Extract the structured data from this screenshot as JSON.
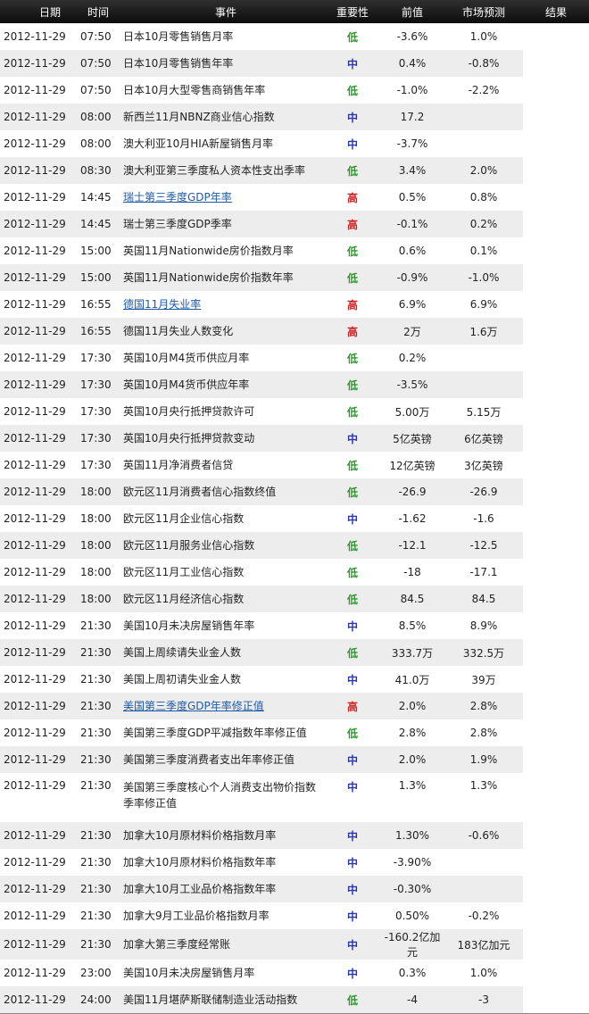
{
  "header": {
    "date": "日期",
    "time": "时间",
    "event": "事件",
    "importance": "重要性",
    "previous": "前值",
    "forecast": "市场预测",
    "result": "结果"
  },
  "colors": {
    "low": "#2a9a2a",
    "mid": "#2a37a8",
    "high": "#cc2222",
    "link": "#1f5aa6"
  },
  "rows": [
    {
      "date": "2012-11-29",
      "time": "07:50",
      "event": "日本10月零售销售月率",
      "importance": "低",
      "level": "low",
      "previous": "-3.6%",
      "forecast": "1.0%"
    },
    {
      "date": "2012-11-29",
      "time": "07:50",
      "event": "日本10月零售销售年率",
      "importance": "中",
      "level": "mid",
      "previous": "0.4%",
      "forecast": "-0.8%"
    },
    {
      "date": "2012-11-29",
      "time": "07:50",
      "event": "日本10月大型零售商销售年率",
      "importance": "低",
      "level": "low",
      "previous": "-1.0%",
      "forecast": "-2.2%"
    },
    {
      "date": "2012-11-29",
      "time": "08:00",
      "event": "新西兰11月NBNZ商业信心指数",
      "importance": "中",
      "level": "mid",
      "previous": "17.2",
      "forecast": ""
    },
    {
      "date": "2012-11-29",
      "time": "08:00",
      "event": "澳大利亚10月HIA新屋销售月率",
      "importance": "中",
      "level": "mid",
      "previous": "-3.7%",
      "forecast": ""
    },
    {
      "date": "2012-11-29",
      "time": "08:30",
      "event": "澳大利亚第三季度私人资本性支出季率",
      "importance": "低",
      "level": "low",
      "previous": "3.4%",
      "forecast": "2.0%"
    },
    {
      "date": "2012-11-29",
      "time": "14:45",
      "event": "瑞士第三季度GDP年率",
      "importance": "高",
      "level": "high",
      "previous": "0.5%",
      "forecast": "0.8%",
      "link": true
    },
    {
      "date": "2012-11-29",
      "time": "14:45",
      "event": "瑞士第三季度GDP季率",
      "importance": "高",
      "level": "high",
      "previous": "-0.1%",
      "forecast": "0.2%"
    },
    {
      "date": "2012-11-29",
      "time": "15:00",
      "event": "英国11月Nationwide房价指数月率",
      "importance": "低",
      "level": "low",
      "previous": "0.6%",
      "forecast": "0.1%"
    },
    {
      "date": "2012-11-29",
      "time": "15:00",
      "event": "英国11月Nationwide房价指数年率",
      "importance": "低",
      "level": "low",
      "previous": "-0.9%",
      "forecast": "-1.0%"
    },
    {
      "date": "2012-11-29",
      "time": "16:55",
      "event": "德国11月失业率",
      "importance": "高",
      "level": "high",
      "previous": "6.9%",
      "forecast": "6.9%",
      "link": true
    },
    {
      "date": "2012-11-29",
      "time": "16:55",
      "event": "德国11月失业人数变化",
      "importance": "高",
      "level": "high",
      "previous": "2万",
      "forecast": "1.6万"
    },
    {
      "date": "2012-11-29",
      "time": "17:30",
      "event": "英国10月M4货币供应月率",
      "importance": "低",
      "level": "low",
      "previous": "0.2%",
      "forecast": ""
    },
    {
      "date": "2012-11-29",
      "time": "17:30",
      "event": "英国10月M4货币供应年率",
      "importance": "低",
      "level": "low",
      "previous": "-3.5%",
      "forecast": ""
    },
    {
      "date": "2012-11-29",
      "time": "17:30",
      "event": "英国10月央行抵押贷款许可",
      "importance": "低",
      "level": "low",
      "previous": "5.00万",
      "forecast": "5.15万"
    },
    {
      "date": "2012-11-29",
      "time": "17:30",
      "event": "英国10月央行抵押贷款变动",
      "importance": "中",
      "level": "mid",
      "previous": "5亿英镑",
      "forecast": "6亿英镑"
    },
    {
      "date": "2012-11-29",
      "time": "17:30",
      "event": "英国11月净消费者信贷",
      "importance": "低",
      "level": "low",
      "previous": "12亿英镑",
      "forecast": "3亿英镑"
    },
    {
      "date": "2012-11-29",
      "time": "18:00",
      "event": "欧元区11月消费者信心指数终值",
      "importance": "低",
      "level": "low",
      "previous": "-26.9",
      "forecast": "-26.9"
    },
    {
      "date": "2012-11-29",
      "time": "18:00",
      "event": "欧元区11月企业信心指数",
      "importance": "中",
      "level": "mid",
      "previous": "-1.62",
      "forecast": "-1.6"
    },
    {
      "date": "2012-11-29",
      "time": "18:00",
      "event": "欧元区11月服务业信心指数",
      "importance": "低",
      "level": "low",
      "previous": "-12.1",
      "forecast": "-12.5"
    },
    {
      "date": "2012-11-29",
      "time": "18:00",
      "event": "欧元区11月工业信心指数",
      "importance": "低",
      "level": "low",
      "previous": "-18",
      "forecast": "-17.1"
    },
    {
      "date": "2012-11-29",
      "time": "18:00",
      "event": "欧元区11月经济信心指数",
      "importance": "低",
      "level": "low",
      "previous": "84.5",
      "forecast": "84.5"
    },
    {
      "date": "2012-11-29",
      "time": "21:30",
      "event": "美国10月未决房屋销售年率",
      "importance": "中",
      "level": "mid",
      "previous": "8.5%",
      "forecast": "8.9%"
    },
    {
      "date": "2012-11-29",
      "time": "21:30",
      "event": "美国上周续请失业金人数",
      "importance": "低",
      "level": "low",
      "previous": "333.7万",
      "forecast": "332.5万"
    },
    {
      "date": "2012-11-29",
      "time": "21:30",
      "event": "美国上周初请失业金人数",
      "importance": "中",
      "level": "mid",
      "previous": "41.0万",
      "forecast": "39万"
    },
    {
      "date": "2012-11-29",
      "time": "21:30",
      "event": "美国第三季度GDP年率修正值",
      "importance": "高",
      "level": "high",
      "previous": "2.0%",
      "forecast": "2.8%",
      "link": true
    },
    {
      "date": "2012-11-29",
      "time": "21:30",
      "event": "美国第三季度GDP平减指数年率修正值",
      "importance": "低",
      "level": "low",
      "previous": "2.8%",
      "forecast": "2.8%"
    },
    {
      "date": "2012-11-29",
      "time": "21:30",
      "event": "美国第三季度消费者支出年率修正值",
      "importance": "中",
      "level": "mid",
      "previous": "2.0%",
      "forecast": "1.9%"
    },
    {
      "date": "2012-11-29",
      "time": "21:30",
      "event": "美国第三季度核心个人消费支出物价指数季率修正值",
      "importance": "中",
      "level": "mid",
      "previous": "1.3%",
      "forecast": "1.3%",
      "tall": true
    },
    {
      "date": "2012-11-29",
      "time": "21:30",
      "event": "加拿大10月原材料价格指数月率",
      "importance": "中",
      "level": "mid",
      "previous": "1.30%",
      "forecast": "-0.6%"
    },
    {
      "date": "2012-11-29",
      "time": "21:30",
      "event": "加拿大10月原材料价格指数年率",
      "importance": "中",
      "level": "mid",
      "previous": "-3.90%",
      "forecast": ""
    },
    {
      "date": "2012-11-29",
      "time": "21:30",
      "event": "加拿大10月工业品价格指数年率",
      "importance": "中",
      "level": "mid",
      "previous": "-0.30%",
      "forecast": ""
    },
    {
      "date": "2012-11-29",
      "time": "21:30",
      "event": "加拿大9月工业品价格指数月率",
      "importance": "中",
      "level": "mid",
      "previous": "0.50%",
      "forecast": "-0.2%"
    },
    {
      "date": "2012-11-29",
      "time": "21:30",
      "event": "加拿大第三季度经常账",
      "importance": "中",
      "level": "mid",
      "previous": "-160.2亿加元",
      "forecast": "183亿加元"
    },
    {
      "date": "2012-11-29",
      "time": "23:00",
      "event": "美国10月未决房屋销售月率",
      "importance": "中",
      "level": "mid",
      "previous": "0.3%",
      "forecast": "1.0%"
    },
    {
      "date": "2012-11-29",
      "time": "24:00",
      "event": "美国11月堪萨斯联储制造业活动指数",
      "importance": "低",
      "level": "low",
      "previous": "-4",
      "forecast": "-3"
    }
  ]
}
